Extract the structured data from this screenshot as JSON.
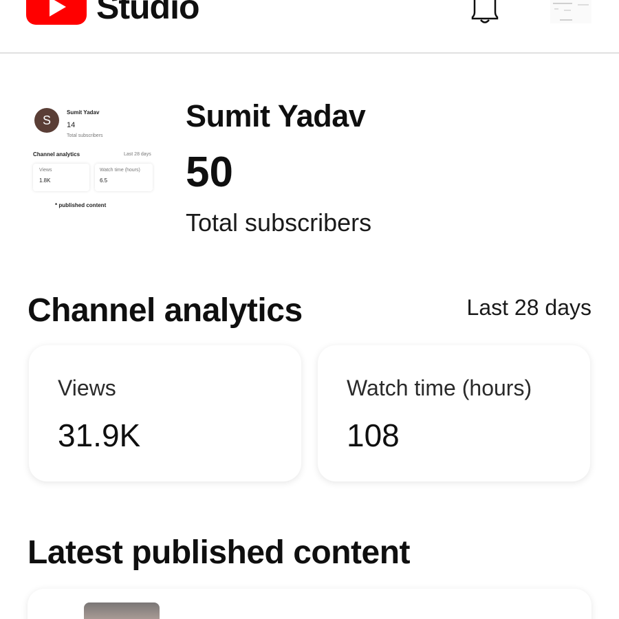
{
  "header": {
    "logo_text": "Studio",
    "logo_color": "#ff0000"
  },
  "channel": {
    "name": "Sumit Yadav",
    "subscriber_count": "50",
    "subscriber_label": "Total subscribers",
    "thumbnail": {
      "avatar_letter": "S",
      "avatar_color": "#5a3e36",
      "name": "Sumit Yadav",
      "subscriber_count": "14",
      "subscriber_label": "Total subscribers",
      "analytics_title": "Channel analytics",
      "period": "Last 28 days",
      "views_label": "Views",
      "views_value": "1.8K",
      "watch_label": "Watch time (hours)",
      "watch_value": "6.5",
      "footer": "published content"
    }
  },
  "analytics": {
    "title": "Channel analytics",
    "period": "Last 28 days",
    "cards": [
      {
        "label": "Views",
        "value": "31.9K"
      },
      {
        "label": "Watch time (hours)",
        "value": "108"
      }
    ]
  },
  "latest": {
    "title": "Latest published content"
  },
  "icons": [
    "youtube-logo-icon",
    "bell-icon",
    "account-thumbnail-icon"
  ]
}
